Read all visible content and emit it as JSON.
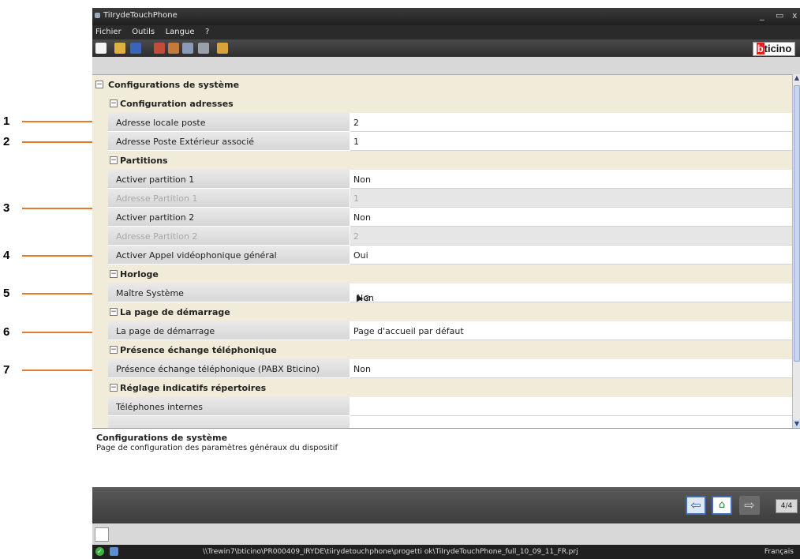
{
  "window": {
    "title": "TiIrydeTouchPhone",
    "controls": {
      "minimize": "_",
      "maximize": "▭",
      "close": "x"
    }
  },
  "menu": [
    "Fichier",
    "Outils",
    "Langue",
    "?"
  ],
  "brand": {
    "logo_first": "b",
    "logo_rest": "ticino",
    "accent": "#e2211c"
  },
  "callouts": [
    "1",
    "2",
    "3",
    "4",
    "5",
    "6",
    "7"
  ],
  "sections": {
    "root": "Configurations de système",
    "adresses": "Configuration adresses",
    "partitions": "Partitions",
    "horloge": "Horloge",
    "demarrage": "La page de démarrage",
    "echange": "Présence échange téléphonique",
    "indicatifs": "Réglage indicatifs répertoires"
  },
  "props": {
    "adresse_locale": {
      "name": "Adresse locale poste",
      "value": "2"
    },
    "adresse_ext": {
      "name": "Adresse Poste Extérieur associé",
      "value": "1"
    },
    "part1": {
      "name": "Activer partition 1",
      "value": "Non"
    },
    "addr_part1": {
      "name": "Adresse Partition 1",
      "value": "1"
    },
    "part2": {
      "name": "Activer partition 2",
      "value": "Non"
    },
    "addr_part2": {
      "name": "Adresse Partition 2",
      "value": "2"
    },
    "appel": {
      "name": "Activer Appel vidéophonique général",
      "value": "Oui"
    },
    "maitre": {
      "name": "Maître Système",
      "value": "Non"
    },
    "page": {
      "name": "La page de démarrage",
      "value": "Page d'accueil par défaut"
    },
    "pabx": {
      "name": "Présence échange téléphonique (PABX Bticino)",
      "value": "Non"
    },
    "tel_int": {
      "name": "Téléphones internes",
      "value": ""
    }
  },
  "description": {
    "title": "Configurations de système",
    "text": "Page de configuration des paramètres généraux du dispositif"
  },
  "pager": "4/4",
  "status": {
    "path": "\\\\Trewin7\\bticino\\PR000409_IRYDE\\tiirydetouchphone\\progetti ok\\TiIrydeTouchPhone_full_10_09_11_FR.prj",
    "language": "Français"
  }
}
